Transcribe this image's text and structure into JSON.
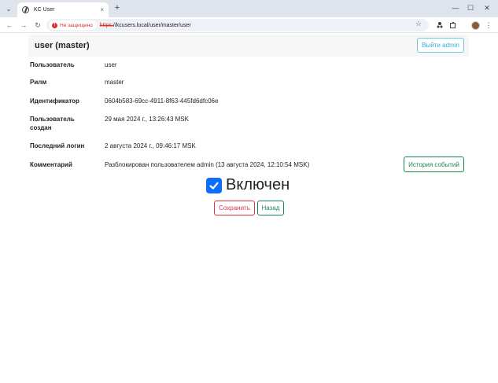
{
  "browser": {
    "tab_title": "KC User",
    "tab_close": "×",
    "new_tab": "+",
    "security_label": "Не защищено",
    "url_scheme": "https:",
    "url_rest": "//kcusers.local/user/master/user",
    "icons": {
      "tab_menu": "chevron-down-icon",
      "back": "arrow-left-icon",
      "forward": "arrow-right-icon",
      "reload": "reload-icon",
      "star": "star-icon",
      "extensions": "puzzle-icon",
      "menu": "more-vert-icon"
    }
  },
  "header": {
    "title": "user (master)",
    "logout_label": "Выйти admin"
  },
  "fields": [
    {
      "label": "Пользователь",
      "value": "user"
    },
    {
      "label": "Рилм",
      "value": "master"
    },
    {
      "label": "Идентификатор",
      "value": "0604b583-69cc-4911-8f63-445fd6dfc06e"
    },
    {
      "label_line1": "Пользователь",
      "label_line2": "создан",
      "value": "29 мая 2024 г., 13:26:43 MSK"
    },
    {
      "label": "Последний логин",
      "value": "2 августа 2024 г., 09:46:17 MSK"
    },
    {
      "label": "Комментарий",
      "value": "Разблокирован пользователем admin  (13 августа 2024, 12:10:54 MSK)"
    }
  ],
  "history_label": "История событий",
  "enabled": {
    "label": "Включен",
    "checked": true
  },
  "actions": {
    "save_label": "Сохранить",
    "back_label": "Назад"
  },
  "colors": {
    "primary": "#0d6efd",
    "success": "#198754",
    "danger": "#dc3545",
    "info": "#31b0d5"
  }
}
